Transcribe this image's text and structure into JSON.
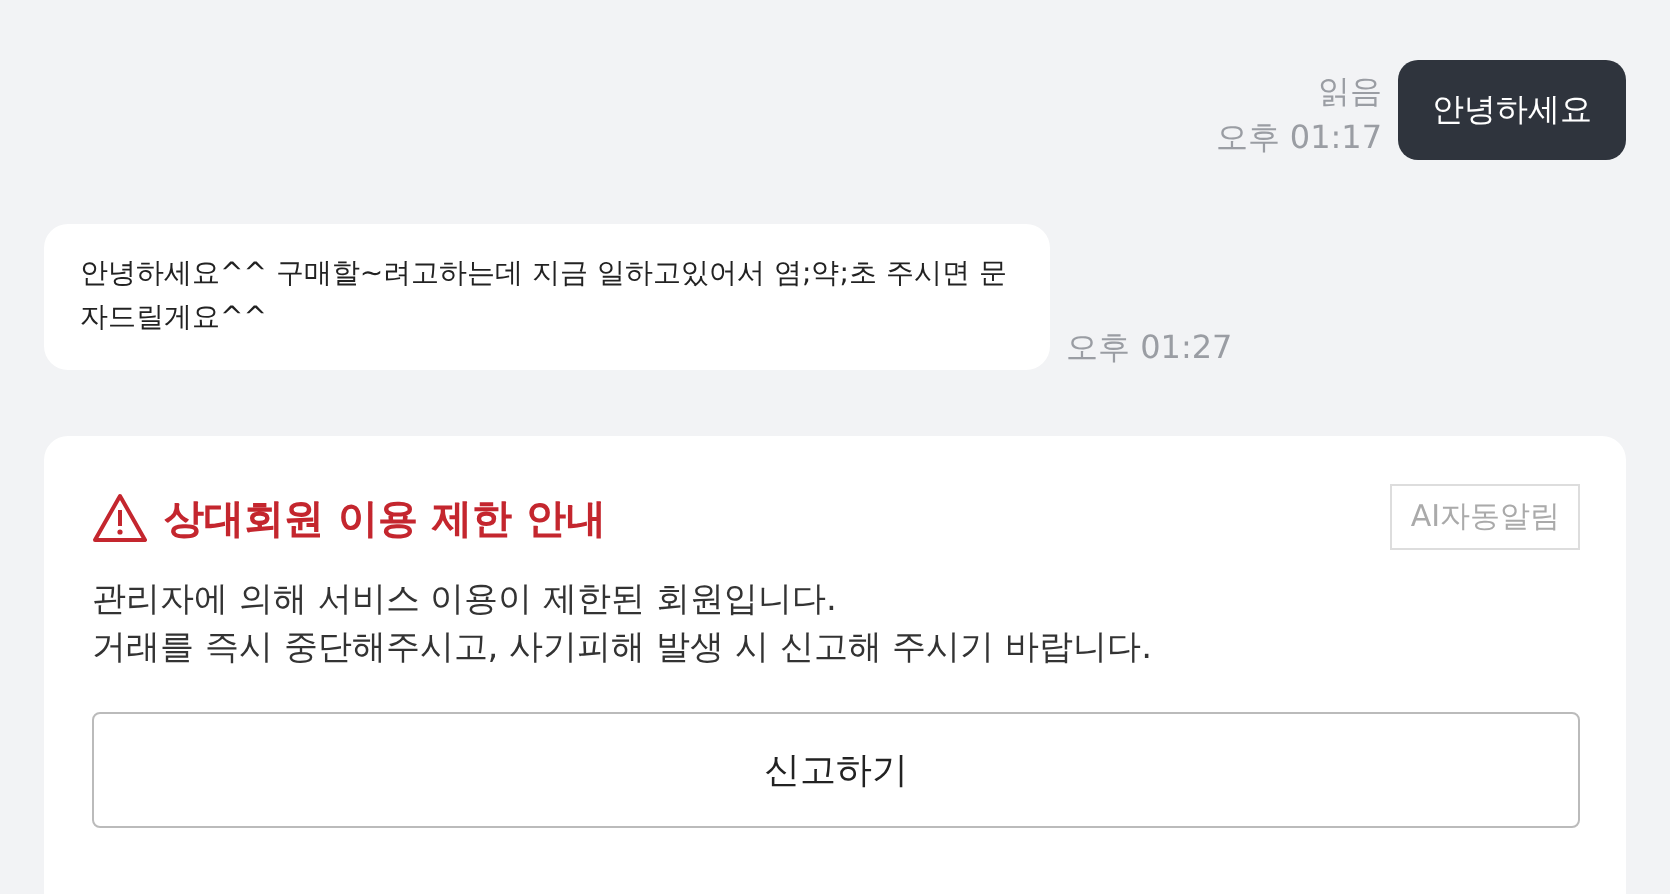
{
  "messages": [
    {
      "kind": "sent",
      "text": "안녕하세요",
      "read_label": "읽음",
      "time": "오후 01:17"
    },
    {
      "kind": "received",
      "text": "안녕하세요^^ 구매할~려고하는데 지금 일하고있어서  염;약;초 주시면 문자드릴게요^^",
      "time": "오후 01:27"
    }
  ],
  "notice": {
    "title": "상대회원 이용 제한 안내",
    "badge": "AI자동알림",
    "lines": [
      "관리자에 의해 서비스 이용이 제한된 회원입니다.",
      "거래를 즉시 중단해주시고, 사기피해 발생 시 신고해 주시기 바랍니다."
    ],
    "button": "신고하기"
  }
}
